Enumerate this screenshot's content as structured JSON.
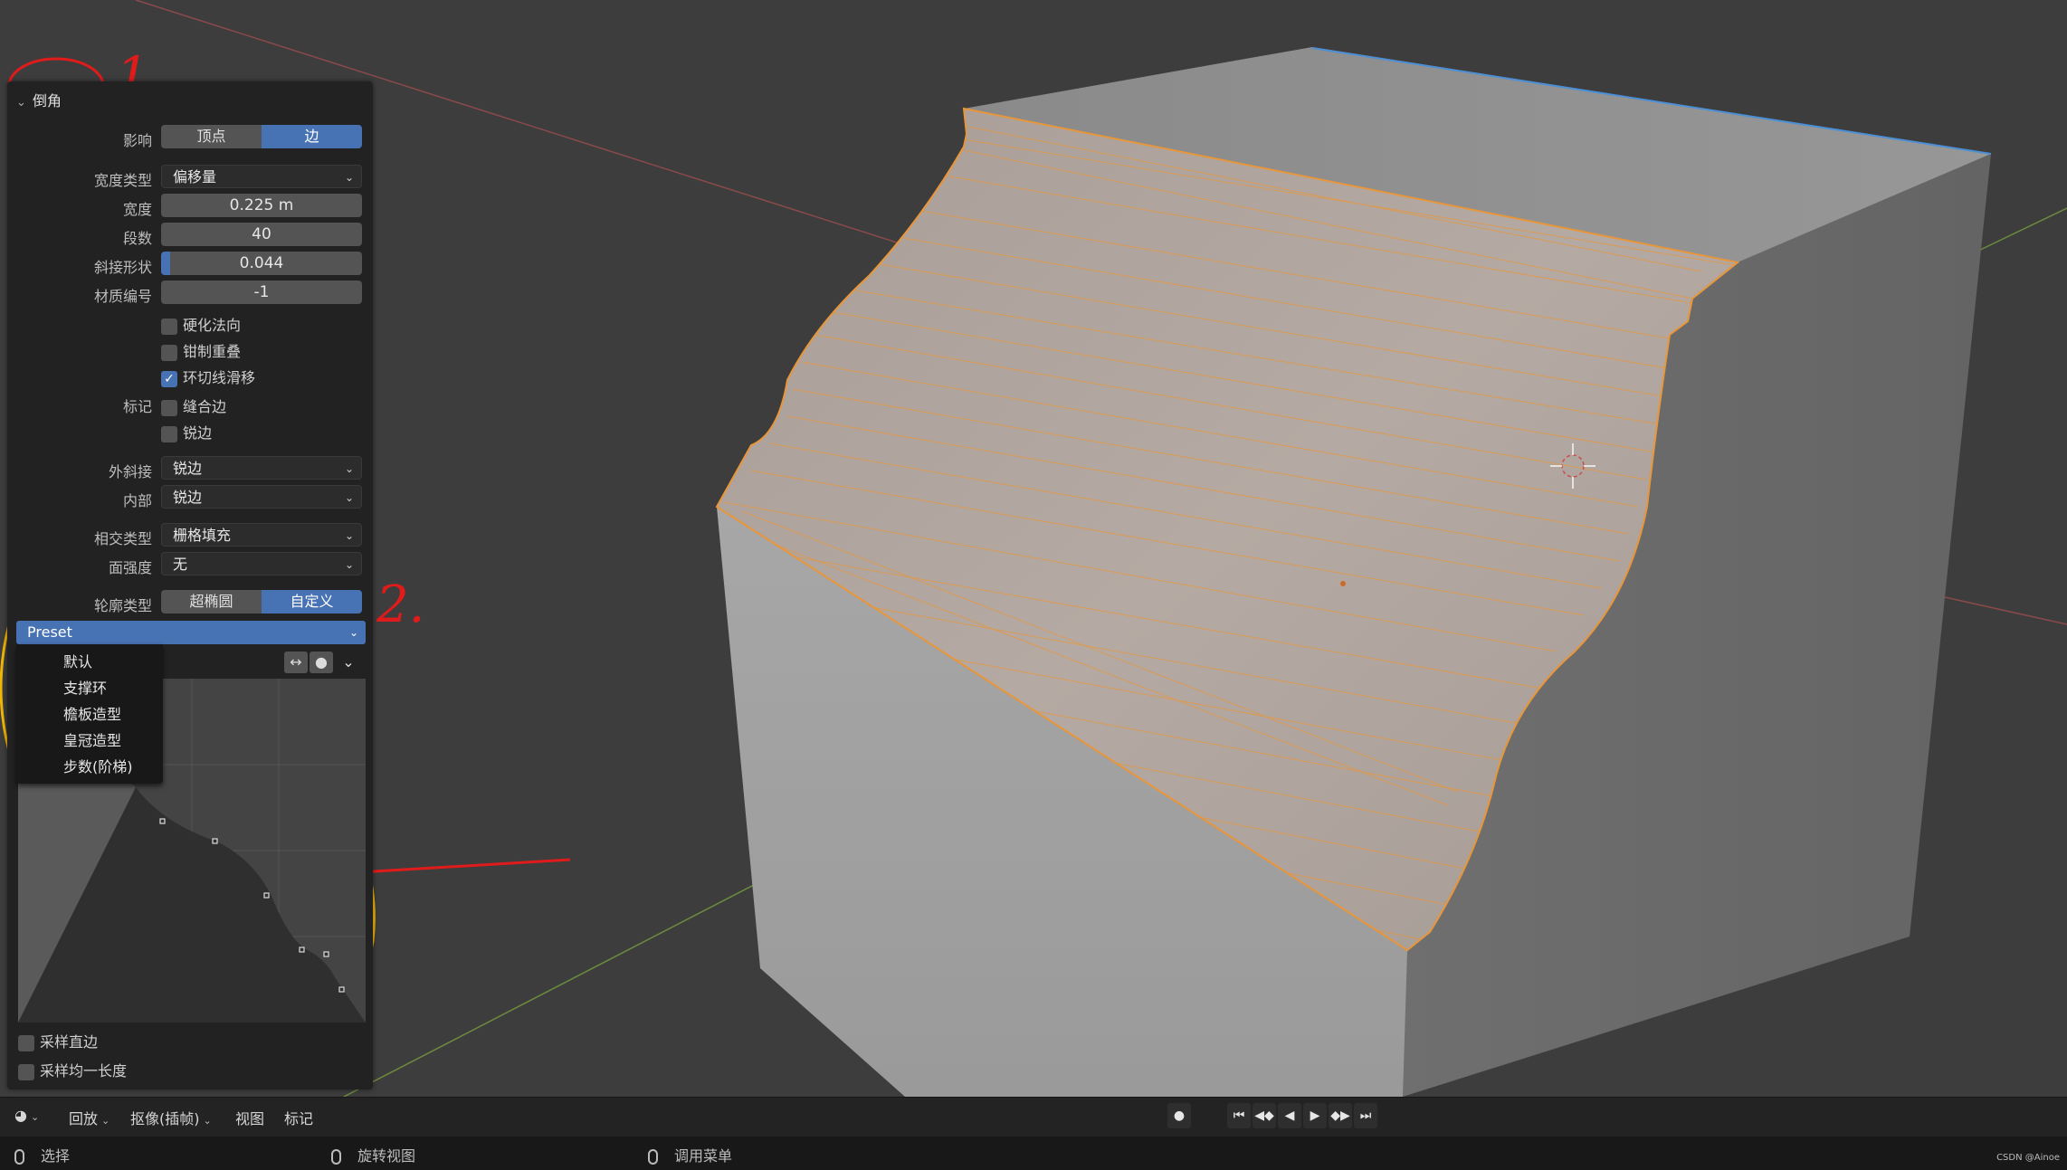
{
  "panel": {
    "title": "倒角",
    "affect": {
      "label": "影响",
      "options": [
        "顶点",
        "边"
      ],
      "selected": "边"
    },
    "width_type": {
      "label": "宽度类型",
      "value": "偏移量"
    },
    "width": {
      "label": "宽度",
      "value": "0.225 m"
    },
    "segments": {
      "label": "段数",
      "value": "40"
    },
    "miter_shape": {
      "label": "斜接形状",
      "value": "0.044",
      "fill_fraction": 0.044
    },
    "material_index": {
      "label": "材质编号",
      "value": "-1"
    },
    "harden_normals": {
      "label": "硬化法向",
      "checked": false
    },
    "clamp_overlap": {
      "label": "钳制重叠",
      "checked": false
    },
    "loop_slide": {
      "label": "环切线滑移",
      "checked": true
    },
    "mark": {
      "label": "标记",
      "seam": "缝合边",
      "sharp": "锐边",
      "seam_checked": false,
      "sharp_checked": false
    },
    "outer_miter": {
      "label": "外斜接",
      "value": "锐边"
    },
    "inner_miter": {
      "label": "内部",
      "value": "锐边"
    },
    "intersection_type": {
      "label": "相交类型",
      "value": "栅格填充"
    },
    "face_strength": {
      "label": "面强度",
      "value": "无"
    },
    "profile_type": {
      "label": "轮廓类型",
      "options": [
        "超椭圆",
        "自定义"
      ],
      "selected": "自定义"
    },
    "preset": {
      "label": "Preset",
      "items": [
        "默认",
        "支撑环",
        "檐板造型",
        "皇冠造型",
        "步数(阶梯)"
      ]
    },
    "sample_straight": {
      "label": "采样直边",
      "checked": false
    },
    "sample_even": {
      "label": "采样均一长度",
      "checked": false
    }
  },
  "annotations": {
    "mark1": "1.",
    "mark2": "2."
  },
  "timeline": {
    "playback": "回放",
    "keying": "抠像(插帧)",
    "view": "视图",
    "marker": "标记"
  },
  "status": {
    "select": "选择",
    "rotate_view": "旋转视图",
    "call_menu": "调用菜单",
    "watermark": "CSDN @Ainoe"
  },
  "colors": {
    "accent": "#4772b3",
    "selection_orange": "#e8963a",
    "annotation_red": "#e01b1b",
    "annotation_yellow": "#f2b705"
  }
}
